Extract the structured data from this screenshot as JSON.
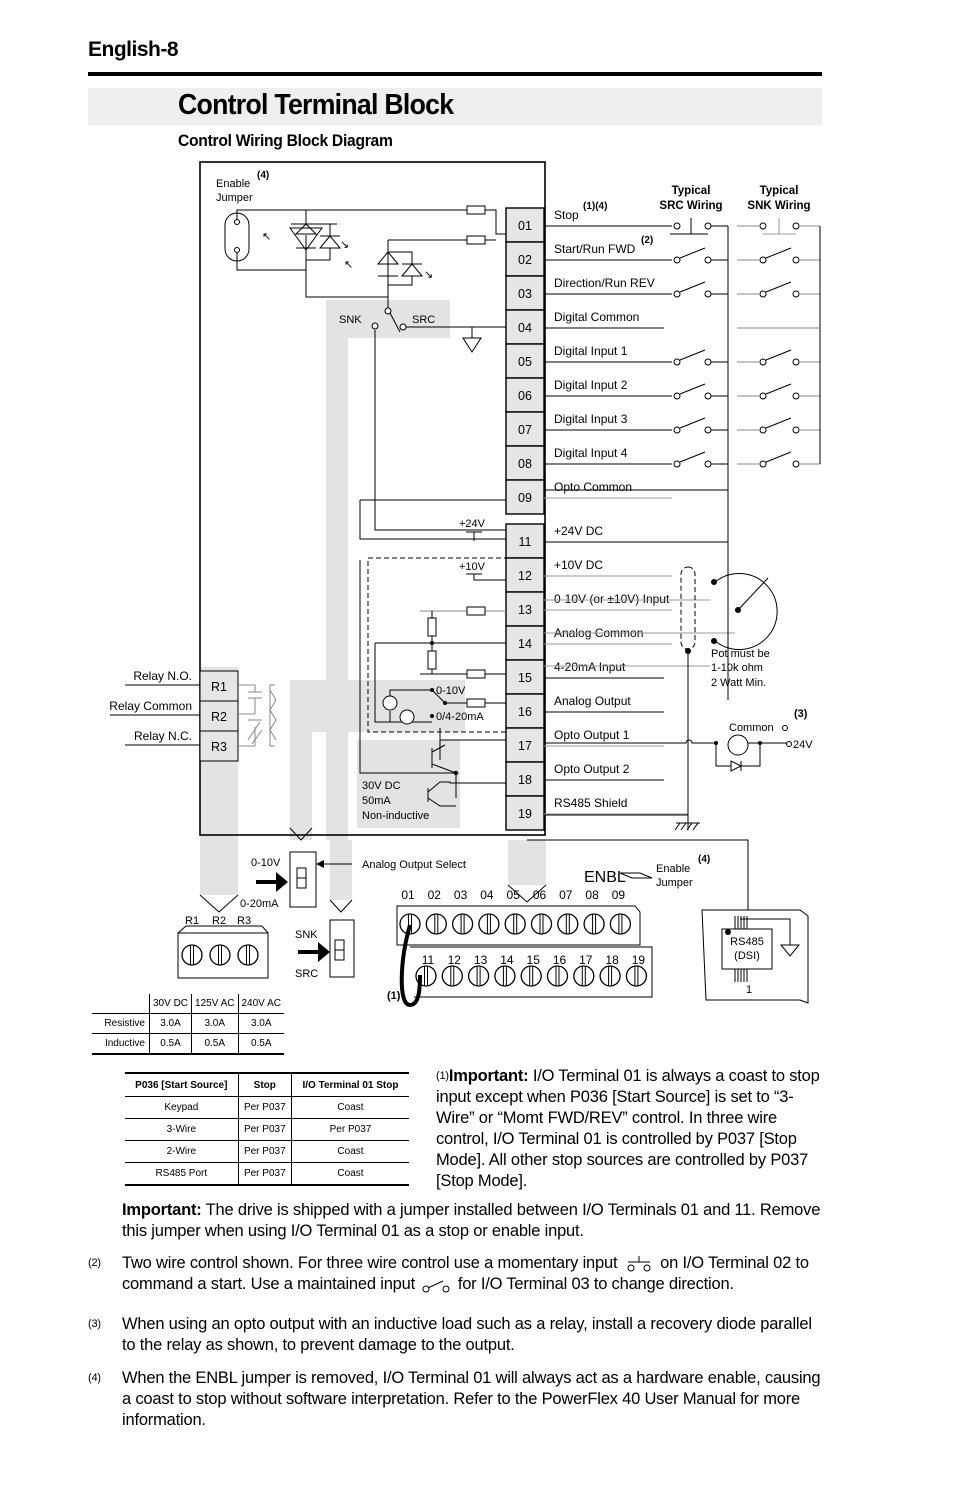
{
  "page": {
    "header": "English-8",
    "title": "Control Terminal Block",
    "subtitle": "Control Wiring Block Diagram"
  },
  "diagram": {
    "enable_jumper_label": "Enable\nJumper",
    "enable_jumper_label_line1": "Enable",
    "enable_jumper_label_line2": "Jumper",
    "footnote_4": "(4)",
    "snk": "SNK",
    "src": "SRC",
    "plus24v": "+24V",
    "plus10v": "+10V",
    "analog_0_10v": "0-10V",
    "analog_0_4_20ma": "0/4-20mA",
    "opto_rating": [
      "30V DC",
      "50mA",
      "Non-inductive"
    ],
    "relay_labels": [
      "Relay N.O.",
      "Relay Common",
      "Relay N.C."
    ],
    "relay_terminals": [
      "R1",
      "R2",
      "R3"
    ],
    "typical_src": [
      "Typical",
      "SRC Wiring"
    ],
    "typical_snk": [
      "Typical",
      "SNK Wiring"
    ],
    "terminals": [
      {
        "id": "01",
        "label": "Stop",
        "note": "(1)(4)"
      },
      {
        "id": "02",
        "label": "Start/Run FWD",
        "note": "(2)"
      },
      {
        "id": "03",
        "label": "Direction/Run REV",
        "note": ""
      },
      {
        "id": "04",
        "label": "Digital Common",
        "note": ""
      },
      {
        "id": "05",
        "label": "Digital Input 1",
        "note": ""
      },
      {
        "id": "06",
        "label": "Digital Input 2",
        "note": ""
      },
      {
        "id": "07",
        "label": "Digital Input 3",
        "note": ""
      },
      {
        "id": "08",
        "label": "Digital Input 4",
        "note": ""
      },
      {
        "id": "09",
        "label": "Opto Common",
        "note": ""
      },
      {
        "id": "11",
        "label": "+24V DC",
        "note": ""
      },
      {
        "id": "12",
        "label": "+10V DC",
        "note": ""
      },
      {
        "id": "13",
        "label": "0-10V (or ±10V) Input",
        "note": ""
      },
      {
        "id": "14",
        "label": "Analog Common",
        "note": ""
      },
      {
        "id": "15",
        "label": "4-20mA Input",
        "note": ""
      },
      {
        "id": "16",
        "label": "Analog Output",
        "note": ""
      },
      {
        "id": "17",
        "label": "Opto Output 1",
        "note": ""
      },
      {
        "id": "18",
        "label": "Opto Output 2",
        "note": ""
      },
      {
        "id": "19",
        "label": "RS485 Shield",
        "note": ""
      }
    ],
    "pot_note": [
      "Pot must be",
      "1-10k ohm",
      "2 Watt Min."
    ],
    "footnote_3": "(3)",
    "common_label": "Common",
    "v24_label": "24V",
    "analog_output_select": "Analog Output Select",
    "switch_0_10v": "0-10V",
    "switch_0_20ma": "0-20mA",
    "switch_snk": "SNK",
    "switch_src": "SRC",
    "block_r_labels": [
      "R1",
      "R2",
      "R3"
    ],
    "block_top_labels": [
      "01",
      "02",
      "03",
      "04",
      "05",
      "06",
      "07",
      "08",
      "09"
    ],
    "block_bottom_labels": [
      "11",
      "12",
      "13",
      "14",
      "15",
      "16",
      "17",
      "18",
      "19"
    ],
    "enbl": "ENBL",
    "enable_jumper2": [
      "Enable",
      "Jumper"
    ],
    "rs485": [
      "RS485",
      "(DSI)"
    ],
    "rs485_pin": "1",
    "jumper_note": "(1)"
  },
  "relay_table": {
    "columns": [
      "",
      "30V DC",
      "125V AC",
      "240V AC"
    ],
    "rows": [
      [
        "Resistive",
        "3.0A",
        "3.0A",
        "3.0A"
      ],
      [
        "Inductive",
        "0.5A",
        "0.5A",
        "0.5A"
      ]
    ]
  },
  "stop_table": {
    "columns": [
      "P036 [Start Source]",
      "Stop",
      "I/O Terminal 01 Stop"
    ],
    "rows": [
      [
        "Keypad",
        "Per P037",
        "Coast"
      ],
      [
        "3-Wire",
        "Per P037",
        "Per P037"
      ],
      [
        "2-Wire",
        "Per P037",
        "Coast"
      ],
      [
        "RS485 Port",
        "Per P037",
        "Coast"
      ]
    ]
  },
  "notes": {
    "note1_sup": "(1)",
    "note1_bold": "Important:",
    "note1_text": " I/O Terminal 01 is always a coast to stop input except when P036 [Start Source] is set to “3-Wire” or “Momt FWD/REV” control. In three wire control, I/O Terminal 01 is controlled by P037 [Stop Mode]. All other stop sources are controlled by P037 [Stop Mode].",
    "important_bold": "Important:",
    "important_text": " The drive is shipped with a jumper installed between I/O Terminals 01 and 11. Remove this jumper when using I/O Terminal 01 as a stop or enable input.",
    "fn2_num": "(2)",
    "fn2_a": "Two wire control shown. For three wire control use a momentary input",
    "fn2_b": "on I/O Terminal 02 to command a start. Use a maintained input",
    "fn2_c": "for I/O Terminal 03 to change direction.",
    "fn3_num": "(3)",
    "fn3_text": "When using an opto output with an inductive load such as a relay, install a recovery diode parallel to the relay as shown, to prevent damage to the output.",
    "fn4_num": "(4)",
    "fn4_text": "When the ENBL jumper is removed, I/O Terminal 01 will always act as a hardware enable, causing a coast to stop without software interpretation. Refer to the PowerFlex 40 User Manual for more information."
  }
}
